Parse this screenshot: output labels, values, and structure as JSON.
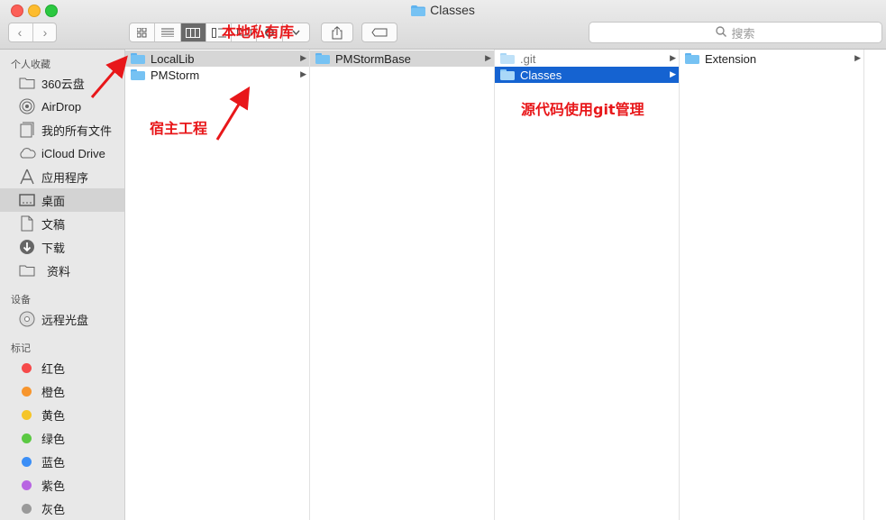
{
  "window": {
    "title": "Classes"
  },
  "search": {
    "placeholder": "搜索"
  },
  "sidebar": {
    "favorites_header": "个人收藏",
    "favorites": [
      {
        "label": "360云盘",
        "icon": "folder-icon"
      },
      {
        "label": "AirDrop",
        "icon": "airdrop-icon"
      },
      {
        "label": "我的所有文件",
        "icon": "all-files-icon"
      },
      {
        "label": "iCloud Drive",
        "icon": "cloud-icon"
      },
      {
        "label": "应用程序",
        "icon": "applications-icon"
      },
      {
        "label": "桌面",
        "icon": "desktop-icon"
      },
      {
        "label": "文稿",
        "icon": "document-icon"
      },
      {
        "label": "下载",
        "icon": "download-icon"
      },
      {
        "label": "资料",
        "icon": "folder-icon"
      }
    ],
    "devices_header": "设备",
    "devices": [
      {
        "label": "远程光盘",
        "icon": "disc-icon"
      }
    ],
    "tags_header": "标记",
    "tags": [
      {
        "label": "红色",
        "color": "#f64a4a"
      },
      {
        "label": "橙色",
        "color": "#f7952d"
      },
      {
        "label": "黄色",
        "color": "#f5c528"
      },
      {
        "label": "绿色",
        "color": "#5bc943"
      },
      {
        "label": "蓝色",
        "color": "#3b8ef6"
      },
      {
        "label": "紫色",
        "color": "#b865e2"
      },
      {
        "label": "灰色",
        "color": "#9a9a9a"
      }
    ]
  },
  "columns": {
    "col1": [
      {
        "label": "LocalLib"
      },
      {
        "label": "PMStorm"
      }
    ],
    "col2": [
      {
        "label": "PMStormBase"
      }
    ],
    "col3": [
      {
        "label": ".git"
      },
      {
        "label": "Classes"
      }
    ],
    "col4": [
      {
        "label": "Extension"
      }
    ]
  },
  "annotations": {
    "local_repo": "本地私有库",
    "host_project": "宿主工程",
    "git_note": "源代码使用git管理"
  },
  "colors": {
    "selection_blue": "#1563d1",
    "annotation_red": "#e8171a",
    "folder_blue": "#5fb3ef"
  }
}
